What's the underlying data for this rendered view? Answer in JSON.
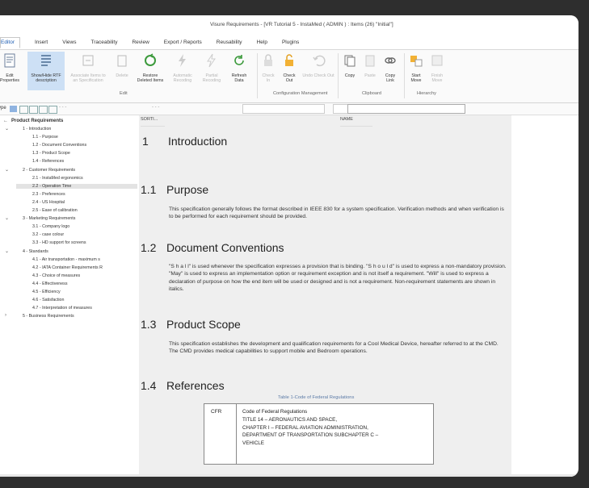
{
  "window": {
    "title": "Visure Requirements - [VR Tutorial 5 - InstaMed ( ADMIN ) : Items (26) \"Initial\"]"
  },
  "menu": [
    "Editor",
    "Insert",
    "Views",
    "Traceability",
    "Review",
    "Export / Reports",
    "Reusability",
    "Help",
    "Plugins"
  ],
  "ribbon": {
    "buttons": {
      "edit_properties": "Edit\nProperties",
      "show_hide_rtf": "Show/Hide RTF\ndescription",
      "associate_items": "Associate Items to\nan Specification",
      "delete": "Delete",
      "restore_deleted": "Restore\nDeleted Items",
      "automatic_recoding": "Automatic\nRecoding",
      "partial_recoding": "Partial\nRecoding",
      "refresh_data": "Refresh\nData",
      "check_in": "Check\nIn",
      "check_out": "Check\nOut",
      "undo_check_out": "Undo Check Out",
      "copy": "Copy",
      "paste": "Paste",
      "copy_link": "Copy\nLink",
      "start_move": "Start\nMove",
      "finish_move": "Finish\nMove"
    },
    "groups": {
      "edit": "Edit",
      "configuration": "Configuration Management",
      "clipboard": "Clipboard",
      "hierarchy": "Hierarchy"
    }
  },
  "filter": {
    "type_label": "ype",
    "dots": "- - -"
  },
  "tree": {
    "root": "Product Requirements",
    "nodes": [
      "1 - Introduction",
      "1.1 - Purpose",
      "1.2 - Document Conventions",
      "1.3 - Product Scope",
      "1.4 - References",
      "2 - Customer Requirements",
      "2.1 - InstaMed ergonomics",
      "2.2 - Operation Time",
      "2.3 - Preferences",
      "2.4 - US Hospital",
      "2.5 - Ease of calibration",
      "3 - Marketing Requirements",
      "3.1 - Company logo",
      "3.2 - case colour",
      "3.3 - HD support for screens",
      "4 - Standards",
      "4.1 - Air transportation - maximum s",
      "4.2 - IATA Container Requirements R",
      "4.3 - Choice of measures",
      "4.4 - Effectiveness",
      "4.5 - Efficiency",
      "4.6 - Satisfaction",
      "4.7 - Interpretation of measures",
      "5 - Business Requirements"
    ],
    "selected": "2.2 - Operation Time"
  },
  "columns": {
    "sort": "SORTI...",
    "name": "NAME"
  },
  "doc": {
    "s1": {
      "num": "1",
      "title": "Introduction"
    },
    "s11": {
      "num": "1.1",
      "title": "Purpose",
      "body": "This specification generally follows the format described in IEEE 830 for a system specification. Verification methods and when verification is to be performed for each requirement should be provided."
    },
    "s12": {
      "num": "1.2",
      "title": "Document Conventions",
      "body": "\"S h a l l\" is used whenever the specification expresses a provision that is binding. \"S h o u l d\" is used to express a non-mandatory provision. \"May\" is used to express an implementation option or requirement exception and is not itself a requirement. \"Will\" is used to express a declaration of purpose on how the end item will be used or designed and is not a requirement. Non-requirement statements are shown in italics."
    },
    "s13": {
      "num": "1.3",
      "title": "Product Scope",
      "body": "This specification establishes the development and qualification requirements for a Cool Medical Device, hereafter referred to at the CMD. The CMD provides medical capabilities to support mobile and Bedroom operations."
    },
    "s14": {
      "num": "1.4",
      "title": "References"
    },
    "table_caption": "Table 1-Code of Federal Regulations",
    "table": {
      "key": "CFR",
      "lines": [
        "Code of Federal Regulations",
        "TITLE 14 – AERONAUTICS AND SPACE,",
        "CHAPTER I – FEDERAL AVIATION ADMINISTRATION,",
        "DEPARTMENT OF TRANSPORTATION SUBCHAPTER C –",
        "VEHICLE"
      ]
    }
  }
}
